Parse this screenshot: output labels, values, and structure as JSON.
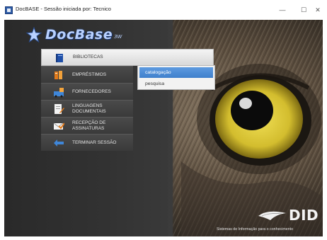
{
  "window": {
    "title": "DocBASE - Sessão iniciada por: Tecnico",
    "controls": {
      "minimize": "—",
      "maximize": "☐",
      "close": "✕"
    }
  },
  "logo": {
    "text": "DocBase",
    "suffix": "3W",
    "icon": "star-logo-icon"
  },
  "menu": [
    {
      "label": "BIBLIOTECAS",
      "icon": "book-icon",
      "active": true
    },
    {
      "label": "EMPRÉSTIMOS",
      "icon": "books-icon",
      "active": false
    },
    {
      "label": "FORNECEDORES",
      "icon": "supplier-icon",
      "active": false
    },
    {
      "label_line1": "LINGUAGENS",
      "label_line2": "DOCUMENTAIS",
      "icon": "document-pen-icon",
      "active": false
    },
    {
      "label_line1": "RECEPÇÃO DE",
      "label_line2": "ASSINATURAS",
      "icon": "envelope-check-icon",
      "active": false
    },
    {
      "label": "TERMINAR SESSÃO",
      "icon": "exit-arrow-icon",
      "active": false
    }
  ],
  "submenu": [
    {
      "label": "catalogação",
      "selected": true
    },
    {
      "label": "pesquisa",
      "selected": false
    }
  ],
  "brand": {
    "name": "DID",
    "tagline": "Sistemas de Informação para o conhecimento"
  },
  "colors": {
    "panel": "#323232",
    "submenu_selected": "#4a89d4",
    "logo_text": "#b9d1ff",
    "owl_eye": "#d8c43a"
  }
}
